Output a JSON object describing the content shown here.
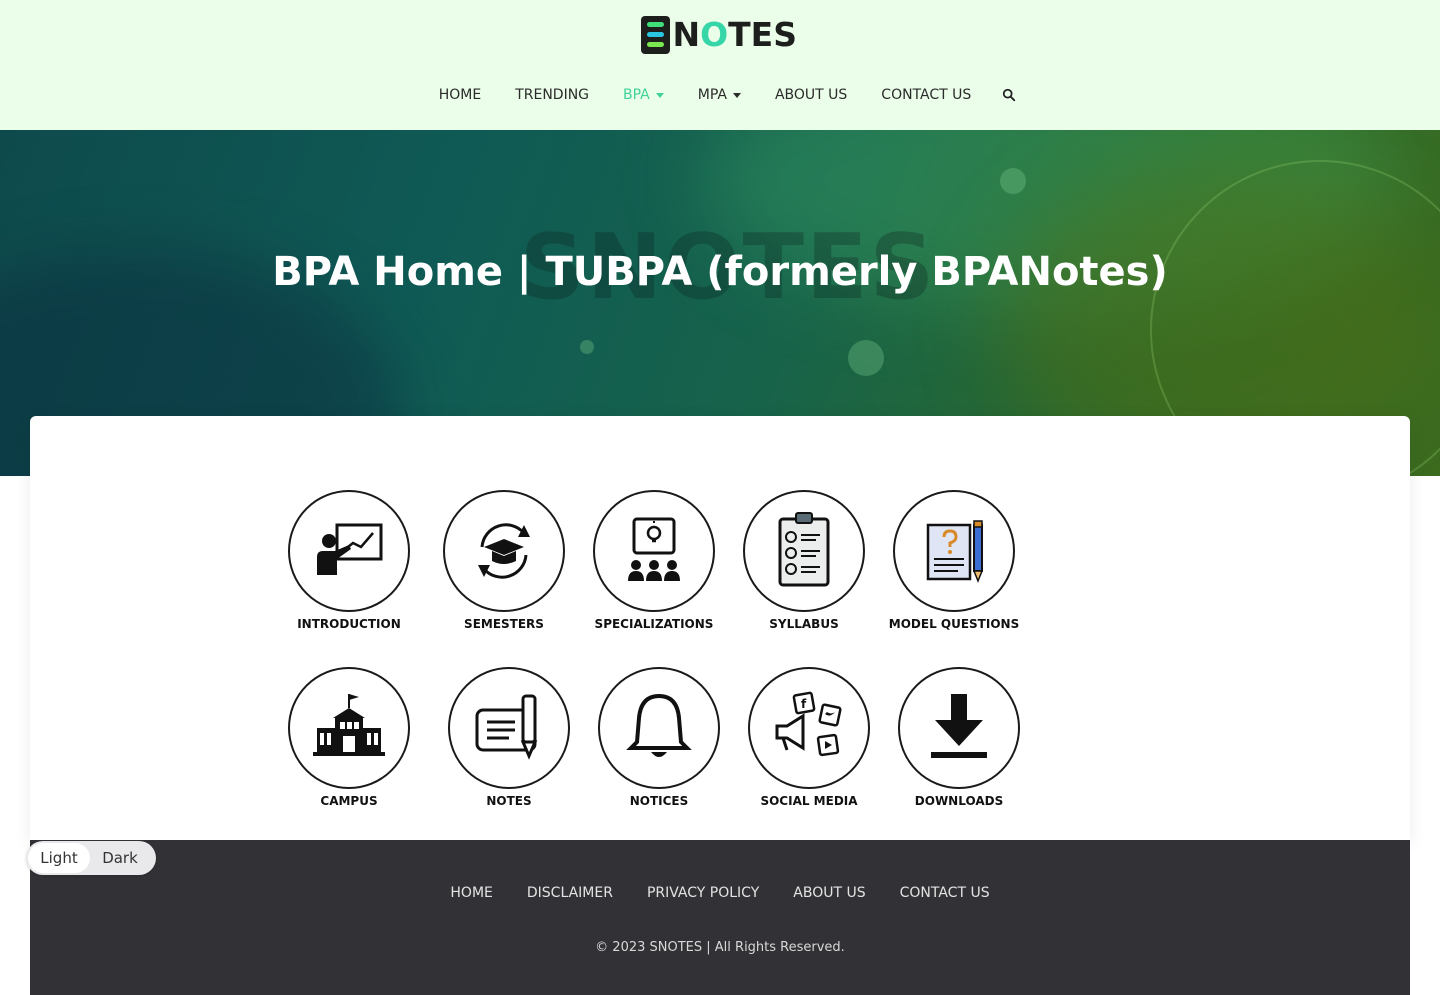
{
  "brand": {
    "logo_text_pre": "N",
    "logo_text_o": "O",
    "logo_text_post": "TES"
  },
  "nav": {
    "items": [
      {
        "label": "HOME",
        "active": false,
        "dropdown": false
      },
      {
        "label": "TRENDING",
        "active": false,
        "dropdown": false
      },
      {
        "label": "BPA",
        "active": true,
        "dropdown": true
      },
      {
        "label": "MPA",
        "active": false,
        "dropdown": true
      },
      {
        "label": "ABOUT US",
        "active": false,
        "dropdown": false
      },
      {
        "label": "CONTACT US",
        "active": false,
        "dropdown": false
      }
    ],
    "search_icon": "search-icon"
  },
  "hero": {
    "title": "BPA Home | TUBPA (formerly BPANotes)",
    "watermark": "SNOTES"
  },
  "tiles": [
    {
      "label": "INTRODUCTION",
      "icon": "teacher-board-icon"
    },
    {
      "label": "SEMESTERS",
      "icon": "graduation-cap-cycle-icon"
    },
    {
      "label": "SPECIALIZATIONS",
      "icon": "idea-group-icon"
    },
    {
      "label": "SYLLABUS",
      "icon": "clipboard-checklist-icon"
    },
    {
      "label": "MODEL QUESTIONS",
      "icon": "question-document-icon"
    },
    {
      "label": "CAMPUS",
      "icon": "building-icon"
    },
    {
      "label": "NOTES",
      "icon": "notes-pen-icon"
    },
    {
      "label": "NOTICES",
      "icon": "bell-icon"
    },
    {
      "label": "SOCIAL MEDIA",
      "icon": "megaphone-social-icon"
    },
    {
      "label": "DOWNLOADS",
      "icon": "download-arrow-icon"
    }
  ],
  "footer": {
    "links": [
      "HOME",
      "DISCLAIMER",
      "PRIVACY POLICY",
      "ABOUT US",
      "CONTACT US"
    ],
    "copyright": "© 2023 SNOTES | All Rights Reserved."
  },
  "theme_toggle": {
    "light": "Light",
    "dark": "Dark",
    "selected": "Light"
  },
  "colors": {
    "header_bg": "#ebfee9",
    "accent": "#3fd29a",
    "footer_bg": "#323236"
  }
}
